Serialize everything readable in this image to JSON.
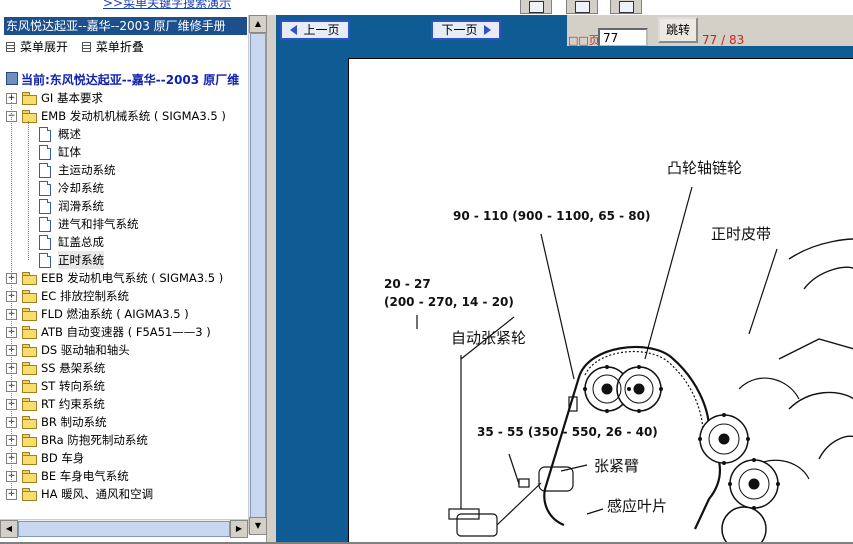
{
  "top_bar": {
    "search_link": ">>菜单关键字搜索演示"
  },
  "sidebar": {
    "manual_title": "东风悦达起亚--嘉华--2003 原厂维修手册",
    "expand_label": "菜单展开",
    "collapse_label": "菜单折叠",
    "current_label": "当前:东风悦达起亚--嘉华--2003 原厂维",
    "tree": [
      {
        "label": "GI 基本要求",
        "type": "folder",
        "expanded": false
      },
      {
        "label": "EMB 发动机机械系统 ( SIGMA3.5 )",
        "type": "folder",
        "expanded": true
      },
      {
        "label": "概述",
        "type": "doc"
      },
      {
        "label": "缸体",
        "type": "doc"
      },
      {
        "label": "主运动系统",
        "type": "doc"
      },
      {
        "label": "冷却系统",
        "type": "doc"
      },
      {
        "label": "润滑系统",
        "type": "doc"
      },
      {
        "label": "进气和排气系统",
        "type": "doc"
      },
      {
        "label": "缸盖总成",
        "type": "doc"
      },
      {
        "label": "正时系统",
        "type": "doc",
        "selected": true
      },
      {
        "label": "EEB 发动机电气系统 ( SIGMA3.5 )",
        "type": "folder",
        "expanded": false
      },
      {
        "label": "EC 排放控制系统",
        "type": "folder",
        "expanded": false
      },
      {
        "label": "FLD 燃油系统 ( AIGMA3.5 )",
        "type": "folder",
        "expanded": false
      },
      {
        "label": "ATB 自动变速器 ( F5A51——3 )",
        "type": "folder",
        "expanded": false
      },
      {
        "label": "DS 驱动轴和轴头",
        "type": "folder",
        "expanded": false
      },
      {
        "label": "SS 悬架系统",
        "type": "folder",
        "expanded": false
      },
      {
        "label": "ST 转向系统",
        "type": "folder",
        "expanded": false
      },
      {
        "label": "RT 约束系统",
        "type": "folder",
        "expanded": false
      },
      {
        "label": "BR 制动系统",
        "type": "folder",
        "expanded": false
      },
      {
        "label": "BRa 防抱死制动系统",
        "type": "folder",
        "expanded": false
      },
      {
        "label": "BD 车身",
        "type": "folder",
        "expanded": false
      },
      {
        "label": "BE 车身电气系统",
        "type": "folder",
        "expanded": false
      },
      {
        "label": "HA 暖风、通风和空调",
        "type": "folder",
        "expanded": false
      }
    ]
  },
  "toolbar": {
    "prev_label": "上一页",
    "next_label": "下一页",
    "page_label": "□□页",
    "page_value": "77",
    "jump_label": "跳转",
    "page_count": "77 / 83"
  },
  "diagram": {
    "torque_1": "90 - 110 (900 - 1100, 65 - 80)",
    "torque_2a": "20 - 27",
    "torque_2b": "(200 - 270, 14 - 20)",
    "torque_3": "35 - 55 (350 - 550, 26 - 40)",
    "label_cam_sprocket": "凸轮轴链轮",
    "label_timing_belt": "正时皮带",
    "label_auto_tensioner": "自动张紧轮",
    "label_tension_arm": "张紧臂",
    "label_sensor_plate": "感应叶片"
  },
  "colors": {
    "toolbar_blue": "#0f5b94",
    "title_blue": "#1c4f8c",
    "accent_red": "#cc2222"
  }
}
